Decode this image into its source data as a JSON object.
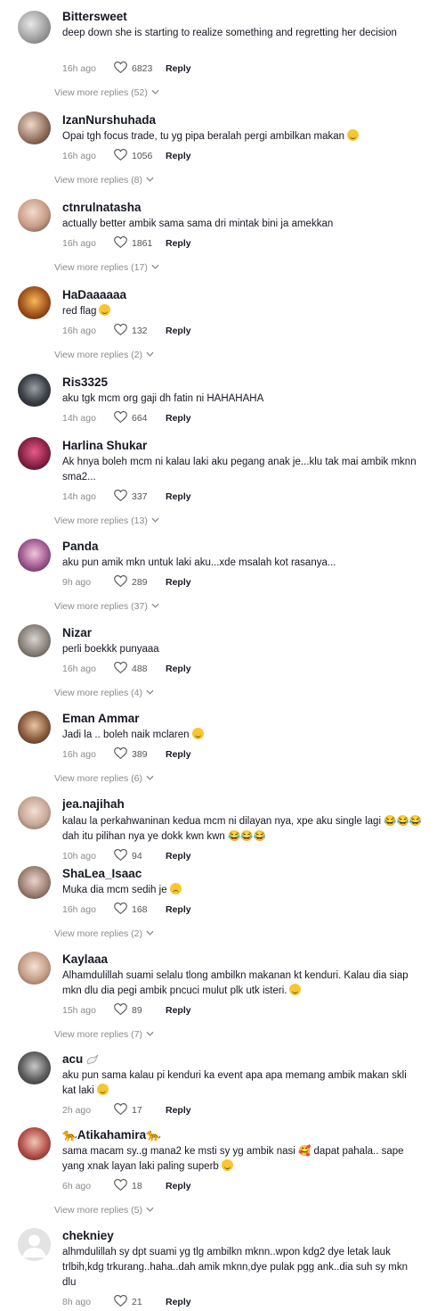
{
  "comments": [
    {
      "name": "Bittersweet",
      "text": "deep down she is starting to realize something and regretting her decision",
      "time": "16h ago",
      "likes": "6823",
      "reply": "Reply",
      "more": "View more replies (52)",
      "emoji": ""
    },
    {
      "name": "IzanNurshuhada",
      "text": "Opai tgh focus trade, tu yg pipa beralah pergi ambilkan makan",
      "time": "16h ago",
      "likes": "1056",
      "reply": "Reply",
      "more": "View more replies (8)",
      "emoji": "smile"
    },
    {
      "name": "ctnrulnatasha",
      "text": "actually better ambik sama sama dri mintak bini ja amekkan",
      "time": "16h ago",
      "likes": "1861",
      "reply": "Reply",
      "more": "View more replies (17)",
      "emoji": ""
    },
    {
      "name": "HaDaaaaaa",
      "text": "red flag",
      "time": "16h ago",
      "likes": "132",
      "reply": "Reply",
      "more": "View more replies (2)",
      "emoji": "smile"
    },
    {
      "name": "Ris3325",
      "text": "aku tgk mcm org gaji dh fatin ni HAHAHAHA",
      "time": "14h ago",
      "likes": "664",
      "reply": "Reply",
      "more": "",
      "emoji": ""
    },
    {
      "name": "Harlina Shukar",
      "text": "Ak hnya boleh mcm ni kalau laki aku pegang anak je...klu tak mai ambik mknn sma2...",
      "time": "14h ago",
      "likes": "337",
      "reply": "Reply",
      "more": "View more replies (13)",
      "emoji": ""
    },
    {
      "name": "Panda",
      "text": "aku pun amik mkn untuk laki aku...xde msalah kot rasanya...",
      "time": "9h ago",
      "likes": "289",
      "reply": "Reply",
      "more": "View more replies (37)",
      "emoji": ""
    },
    {
      "name": "Nizar",
      "text": "perli boekkk punyaaa",
      "time": "16h ago",
      "likes": "488",
      "reply": "Reply",
      "more": "View more replies (4)",
      "emoji": ""
    },
    {
      "name": "Eman Ammar",
      "text": "Jadi la .. boleh naik mclaren",
      "time": "16h ago",
      "likes": "389",
      "reply": "Reply",
      "more": "View more replies (6)",
      "emoji": "smile"
    },
    {
      "name": "jea.najihah",
      "text": "kalau la perkahwaninan kedua mcm ni dilayan nya, xpe aku single lagi 😂😂😂 dah itu pilihan nya ye dokk kwn kwn 😂😂😂",
      "time": "10h ago",
      "likes": "94",
      "reply": "Reply",
      "more": "",
      "emoji": ""
    },
    {
      "name": "ShaLea_Isaac",
      "text": "Muka dia mcm sedih je",
      "time": "16h ago",
      "likes": "168",
      "reply": "Reply",
      "more": "View more replies (2)",
      "emoji": "sad"
    },
    {
      "name": "Kaylaaa",
      "text": "Alhamdulillah suami selalu tlong ambilkn makanan kt kenduri. Kalau dia siap mkn dlu dia pegi ambik pncuci mulut plk utk isteri.",
      "time": "15h ago",
      "likes": "89",
      "reply": "Reply",
      "more": "View more replies (7)",
      "emoji": "smile"
    },
    {
      "name": "acu",
      "text": "aku pun sama kalau pi kenduri ka event apa apa memang ambik makan skli kat laki",
      "time": "2h ago",
      "likes": "17",
      "reply": "Reply",
      "more": "",
      "emoji": "smile"
    },
    {
      "name": "🐆Atikahamira🐆",
      "text": "sama macam sy..g mana2 ke msti sy yg ambik nasi 🥰 dapat pahala.. sape yang xnak layan laki paling superb",
      "time": "6h ago",
      "likes": "18",
      "reply": "Reply",
      "more": "View more replies (5)",
      "emoji": "smile"
    },
    {
      "name": "chekniey",
      "text": "alhmdulillah sy dpt suami yg tlg ambilkn mknn..wpon kdg2 dye letak lauk trlbih,kdg trkurang..haha..dah amik mknn,dye pulak pgg ank..dia suh sy mkn dlu",
      "time": "8h ago",
      "likes": "21",
      "reply": "Reply",
      "more": "",
      "emoji": ""
    }
  ],
  "colors": {
    "text": "#161823",
    "muted": "#8a8b91",
    "emoji": "#f7c631"
  },
  "icons": {
    "like": "heart-outline-icon",
    "more": "chevron-down-icon",
    "acu": "dove-icon"
  }
}
